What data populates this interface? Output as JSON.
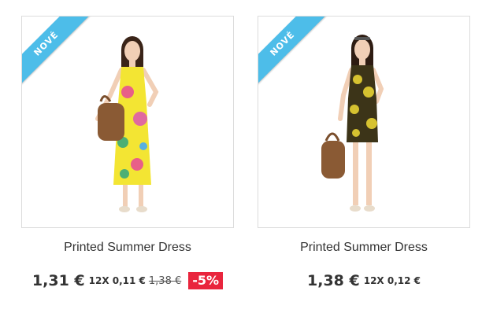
{
  "products": [
    {
      "badge": "NOVÉ",
      "name": "Printed Summer Dress",
      "price": "1,31 €",
      "installments": "12X 0,11 €",
      "old_price": "1,38 €",
      "discount": "-5%"
    },
    {
      "badge": "NOVÉ",
      "name": "Printed Summer Dress",
      "price": "1,38 €",
      "installments": "12X 0,12 €"
    }
  ],
  "colors": {
    "ribbon": "#4dbde9",
    "discount": "#e9253d",
    "text": "#333333"
  }
}
